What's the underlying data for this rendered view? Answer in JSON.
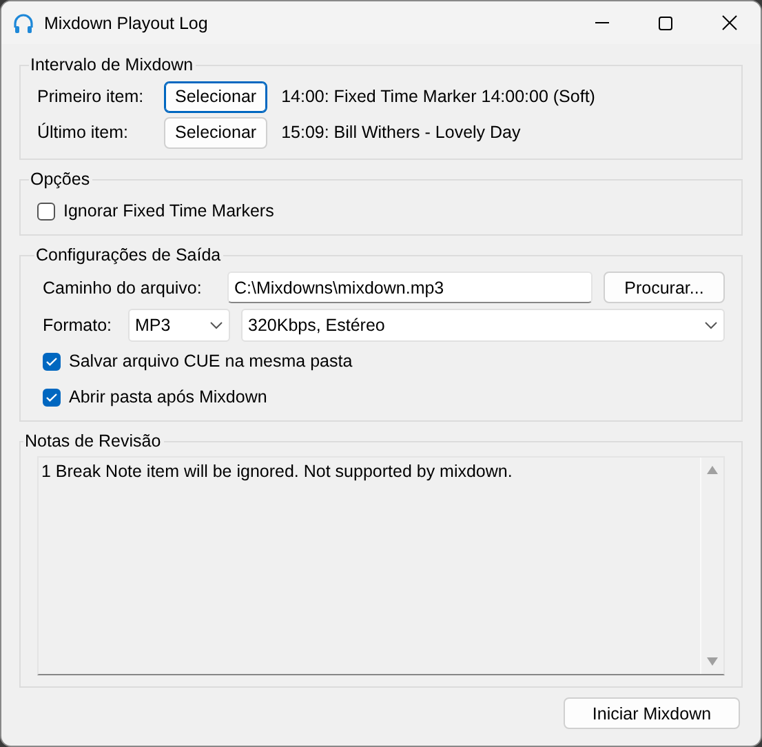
{
  "window": {
    "title": "Mixdown Playout Log"
  },
  "range": {
    "title": "Intervalo de Mixdown",
    "rows": [
      {
        "label": "Primeiro item:",
        "button": "Selecionar",
        "focused": true,
        "value": "14:00: Fixed Time Marker 14:00:00 (Soft)"
      },
      {
        "label": "Último item:",
        "button": "Selecionar",
        "focused": false,
        "value": "15:09: Bill Withers - Lovely Day"
      }
    ]
  },
  "options": {
    "title": "Opções",
    "checkboxes": [
      {
        "label": "Ignorar Fixed Time Markers",
        "checked": false
      }
    ]
  },
  "output": {
    "title": "Configurações de Saída",
    "path_label": "Caminho do arquivo:",
    "path": "C:\\Mixdowns\\mixdown.mp3",
    "browse_button": "Procurar...",
    "format_label": "Formato:",
    "format": "MP3",
    "quality": "320Kbps, Estéreo",
    "checkboxes": [
      {
        "label": "Salvar arquivo CUE na mesma pasta",
        "checked": true
      },
      {
        "label": "Abrir pasta após Mixdown",
        "checked": true
      }
    ]
  },
  "notes": {
    "title": "Notas de Revisão",
    "text": "1 Break Note item will be ignored. Not supported by mixdown."
  },
  "start_button": "Iniciar Mixdown"
}
